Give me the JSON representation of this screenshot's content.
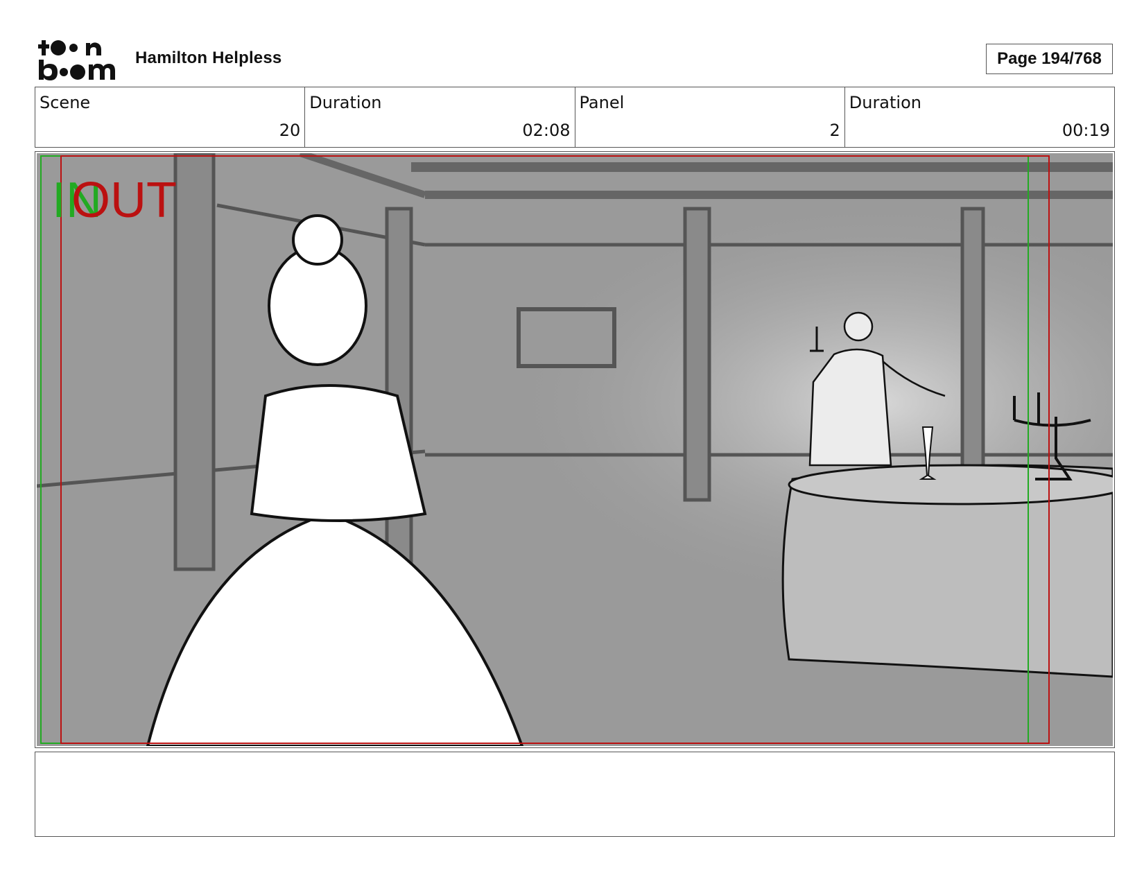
{
  "header": {
    "logo": {
      "line1": "toon",
      "line2": "boom"
    },
    "project_title": "Hamilton Helpless",
    "page_label": "Page 194/768"
  },
  "info": {
    "scene_label": "Scene",
    "scene_value": "20",
    "scene_duration_label": "Duration",
    "scene_duration_value": "02:08",
    "panel_label": "Panel",
    "panel_value": "2",
    "panel_duration_label": "Duration",
    "panel_duration_value": "00:19"
  },
  "panel": {
    "in_marker": "IN",
    "out_marker": "OUT",
    "colors": {
      "in": "#22aa22",
      "out": "#bb1111",
      "wall": "#9a9a9a",
      "beam": "#6a6a6a"
    }
  },
  "notes": {}
}
